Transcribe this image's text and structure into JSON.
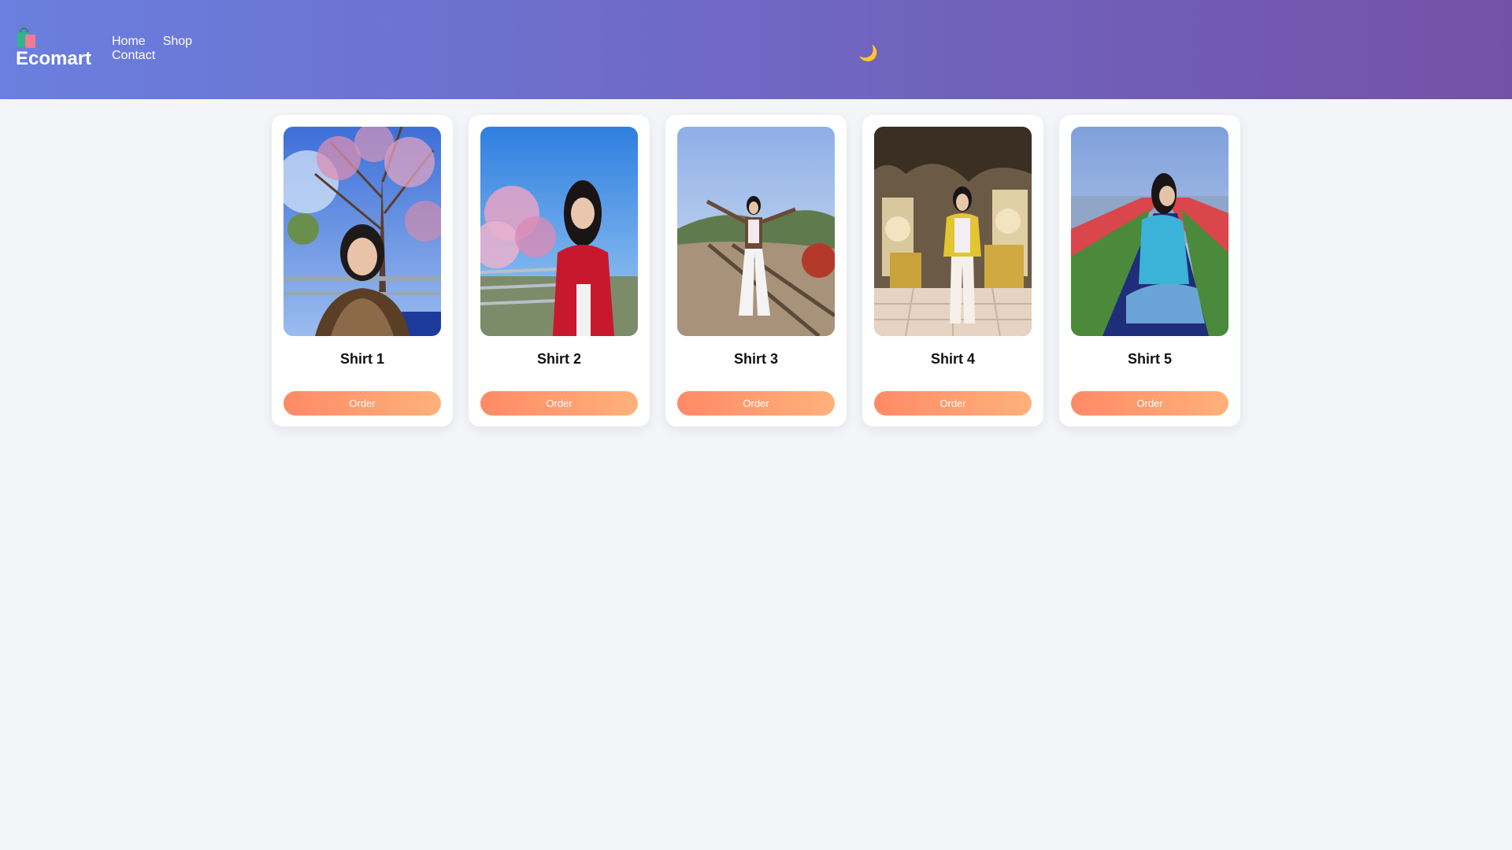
{
  "brand": {
    "name": "Ecomart",
    "icon": "shopping-bags-icon"
  },
  "nav": {
    "home": "Home",
    "shop": "Shop",
    "contact": "Contact"
  },
  "theme_toggle": {
    "icon": "moon-icon",
    "glyph": "🌙"
  },
  "colors": {
    "header_gradient_start": "#6a7fdf",
    "header_gradient_end": "#7451a8",
    "button_gradient_start": "#ff8a66",
    "button_gradient_end": "#ffb17a",
    "page_background": "#f4f5f9"
  },
  "products": [
    {
      "title": "Shirt 1",
      "button": "Order"
    },
    {
      "title": "Shirt 2",
      "button": "Order"
    },
    {
      "title": "Shirt 3",
      "button": "Order"
    },
    {
      "title": "Shirt 4",
      "button": "Order"
    },
    {
      "title": "Shirt 5",
      "button": "Order"
    }
  ]
}
